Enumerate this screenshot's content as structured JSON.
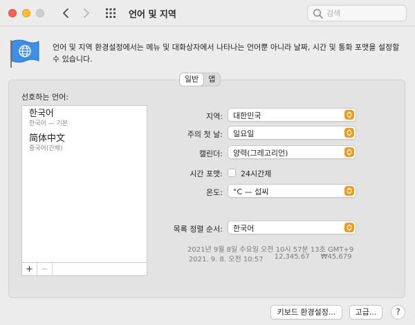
{
  "window": {
    "title": "언어 및 지역"
  },
  "search": {
    "placeholder": "검색",
    "value": ""
  },
  "icons": {
    "back": "chevron-left-icon",
    "forward": "chevron-right-icon",
    "grid": "grid-icon",
    "search": "search-icon",
    "prefs": "globe-flag-icon"
  },
  "colors": {
    "accent": "#f29a1e",
    "close": "#fe5f57",
    "minimize": "#febc2e",
    "flag": "#3d8ee6"
  },
  "description": "언어 및 지역 환경설정에서는 메뉴 및 대화상자에서 나타나는 언어뿐 아니라 날짜, 시간 및 통화 포맷을 설정할 수 있습니다.",
  "tabs": [
    {
      "label": "일반",
      "active": true
    },
    {
      "label": "앱",
      "active": false
    }
  ],
  "languages": {
    "label": "선호하는 언어:",
    "items": [
      {
        "name": "한국어",
        "sub": "한국어 — 기본"
      },
      {
        "name": "简体中文",
        "sub": "중국어(간체)"
      }
    ],
    "add_label": "+",
    "remove_label": "−"
  },
  "settings": {
    "region": {
      "label": "지역:",
      "value": "대한민국"
    },
    "first_day": {
      "label": "주의 첫 날:",
      "value": "일요일"
    },
    "calendar": {
      "label": "캘린더:",
      "value": "양력(그레고리언)"
    },
    "time_format": {
      "label": "시간 포맷:",
      "checkbox_label": "24시간제",
      "checked": false
    },
    "temperature": {
      "label": "온도:",
      "value": "°C — 섭씨"
    },
    "list_sort": {
      "label": "목록 정렬 순서:",
      "value": "한국어"
    }
  },
  "samples": {
    "line1": "2021년 9월 8일 수요일 오전 10시 57분 13초 GMT+9",
    "date": "2021. 9. 8. 오전 10:57",
    "number": "12,345.67",
    "currency": "₩45,679"
  },
  "buttons": {
    "keyboard": "키보드 환경설정...",
    "advanced": "고급...",
    "help": "?"
  }
}
